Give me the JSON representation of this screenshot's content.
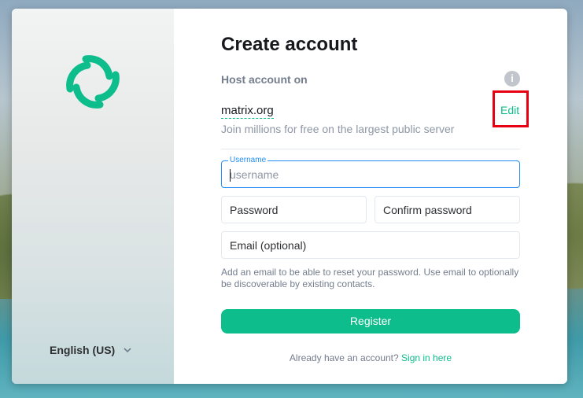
{
  "colors": {
    "accent": "#0dbd8b",
    "focus": "#238cf5",
    "highlight": "#e60012"
  },
  "sidebar": {
    "logo_icon": "element-logo-icon",
    "language": "English (US)",
    "language_icon": "chevron-down-icon"
  },
  "form": {
    "title": "Create account",
    "host_label": "Host account on",
    "info_icon": "info-icon",
    "server": "matrix.org",
    "edit_label": "Edit",
    "server_description": "Join millions for free on the largest public server",
    "username_label": "Username",
    "username_placeholder": "username",
    "password_placeholder": "Password",
    "confirm_placeholder": "Confirm password",
    "email_placeholder": "Email (optional)",
    "email_help": "Add an email to be able to reset your password. Use email to optionally be discoverable by existing contacts.",
    "register_label": "Register",
    "signin_prompt": "Already have an account?",
    "signin_link": "Sign in here"
  }
}
